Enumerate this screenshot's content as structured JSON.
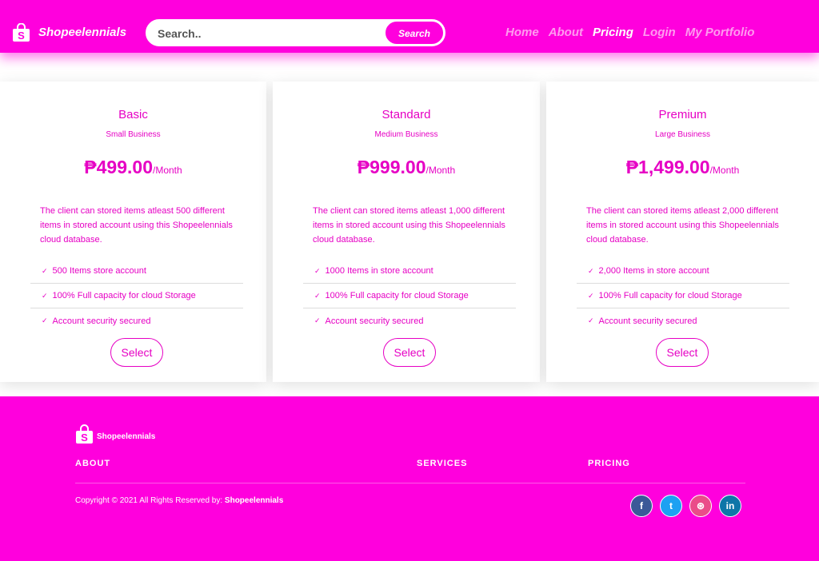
{
  "header": {
    "brand": "Shopeelennials",
    "search_placeholder": "Search..",
    "search_button": "Search",
    "nav": [
      {
        "label": "Home",
        "active": false
      },
      {
        "label": "About",
        "active": false
      },
      {
        "label": "Pricing",
        "active": true
      },
      {
        "label": "Login",
        "active": false
      },
      {
        "label": "My Portfolio",
        "active": false
      }
    ]
  },
  "plans": [
    {
      "title": "Basic",
      "subtitle": "Small Business",
      "price": "₱499.00",
      "period": "/Month",
      "description": "The client can stored items atleast 500 different items in stored account using this Shopeelennials cloud database.",
      "features": [
        "500 Items store account",
        "100% Full capacity for cloud Storage",
        "Account security secured"
      ],
      "button": "Select"
    },
    {
      "title": "Standard",
      "subtitle": "Medium Business",
      "price": "₱999.00",
      "period": "/Month",
      "description": "The client can stored items atleast 1,000 different items in stored account using this Shopeelennials cloud database.",
      "features": [
        "1000 Items in store account",
        "100% Full capacity for cloud Storage",
        "Account security secured"
      ],
      "button": "Select"
    },
    {
      "title": "Premium",
      "subtitle": "Large Business",
      "price": "₱1,499.00",
      "period": "/Month",
      "description": "The client can stored items atleast 2,000 different items in stored account using this Shopeelennials cloud database.",
      "features": [
        "2,000 Items in store account",
        "100% Full capacity for cloud Storage",
        "Account security secured"
      ],
      "button": "Select"
    }
  ],
  "footer": {
    "brand": "Shopeelennials",
    "columns": [
      "ABOUT",
      "SERVICES",
      "PRICING"
    ],
    "copyright_prefix": "Copyright © 2021 All Rights Reserved by:",
    "copyright_brand": "Shopeelennials",
    "socials": [
      {
        "icon": "facebook-icon",
        "glyph": "f",
        "color": "#3b5998"
      },
      {
        "icon": "twitter-icon",
        "glyph": "t",
        "color": "#1da1f2"
      },
      {
        "icon": "dribbble-icon",
        "glyph": "⊛",
        "color": "#ea4c89"
      },
      {
        "icon": "linkedin-icon",
        "glyph": "in",
        "color": "#0e76a8"
      }
    ]
  },
  "colors": {
    "brand": "#ff00dd",
    "accent_text": "#e600c4",
    "nav_inactive": "#ff9af0"
  }
}
